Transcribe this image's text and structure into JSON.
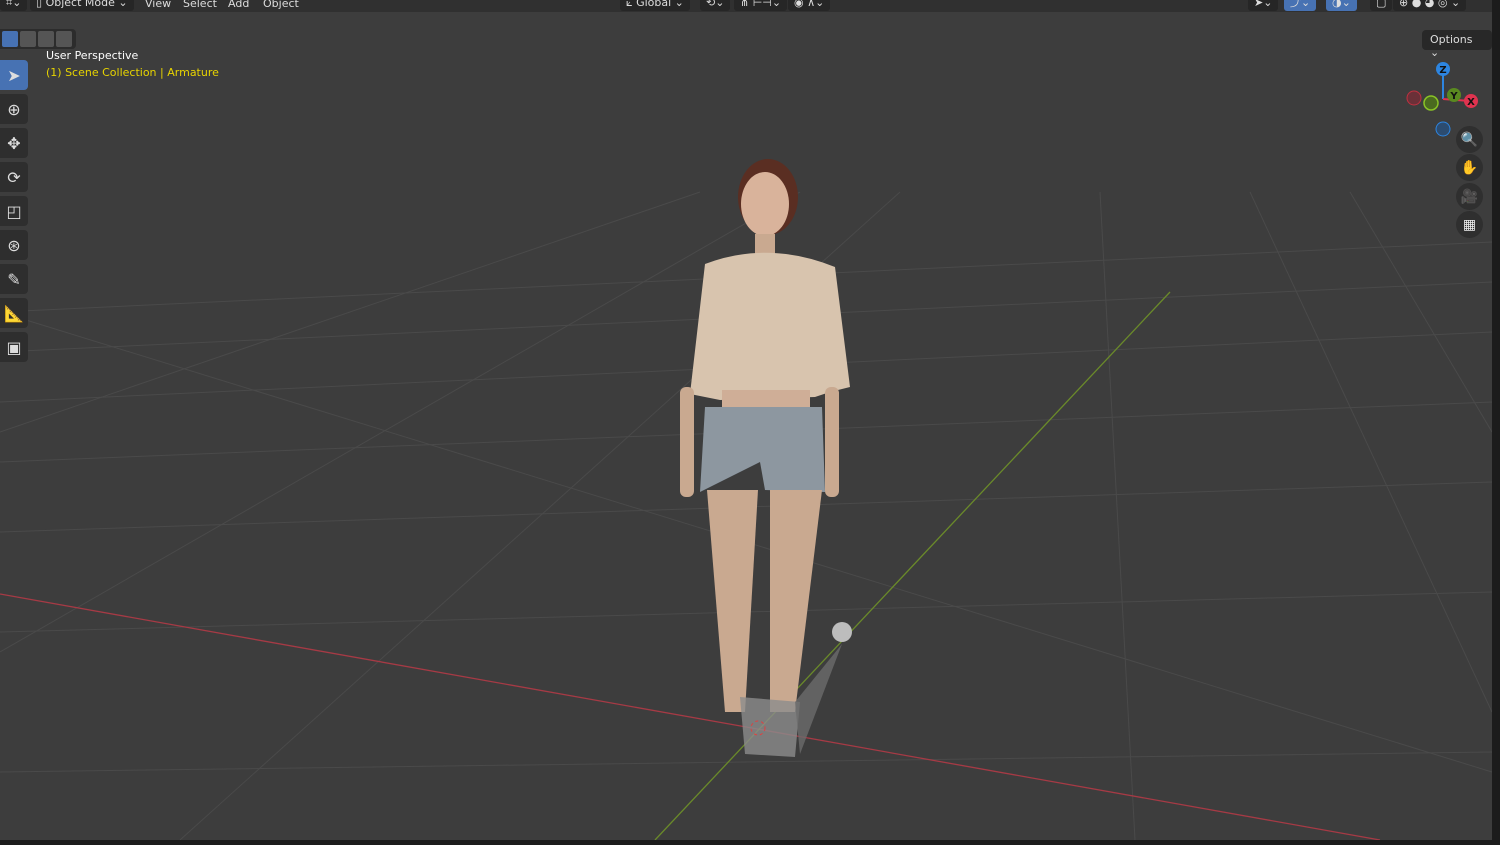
{
  "header": {
    "mode": "Object Mode",
    "menus": [
      "View",
      "Select",
      "Add",
      "Object"
    ],
    "transform_orientation": "Global",
    "options_label": "Options"
  },
  "overlay": {
    "view_name": "User Perspective",
    "collection": "(1) Scene Collection",
    "object": "Armature",
    "separator": "|"
  },
  "gizmo": {
    "z": "Z",
    "y": "Y",
    "x": "X",
    "colors": {
      "x": "#e0334f",
      "y": "#8ac426",
      "z": "#2d85e0"
    }
  },
  "tools": [
    "select-box",
    "cursor",
    "move",
    "rotate",
    "scale",
    "transform",
    "annotate",
    "measure",
    "add-cube"
  ],
  "nav": [
    "zoom-icon",
    "pan-hand-icon",
    "camera-icon",
    "ortho-grid-icon"
  ]
}
